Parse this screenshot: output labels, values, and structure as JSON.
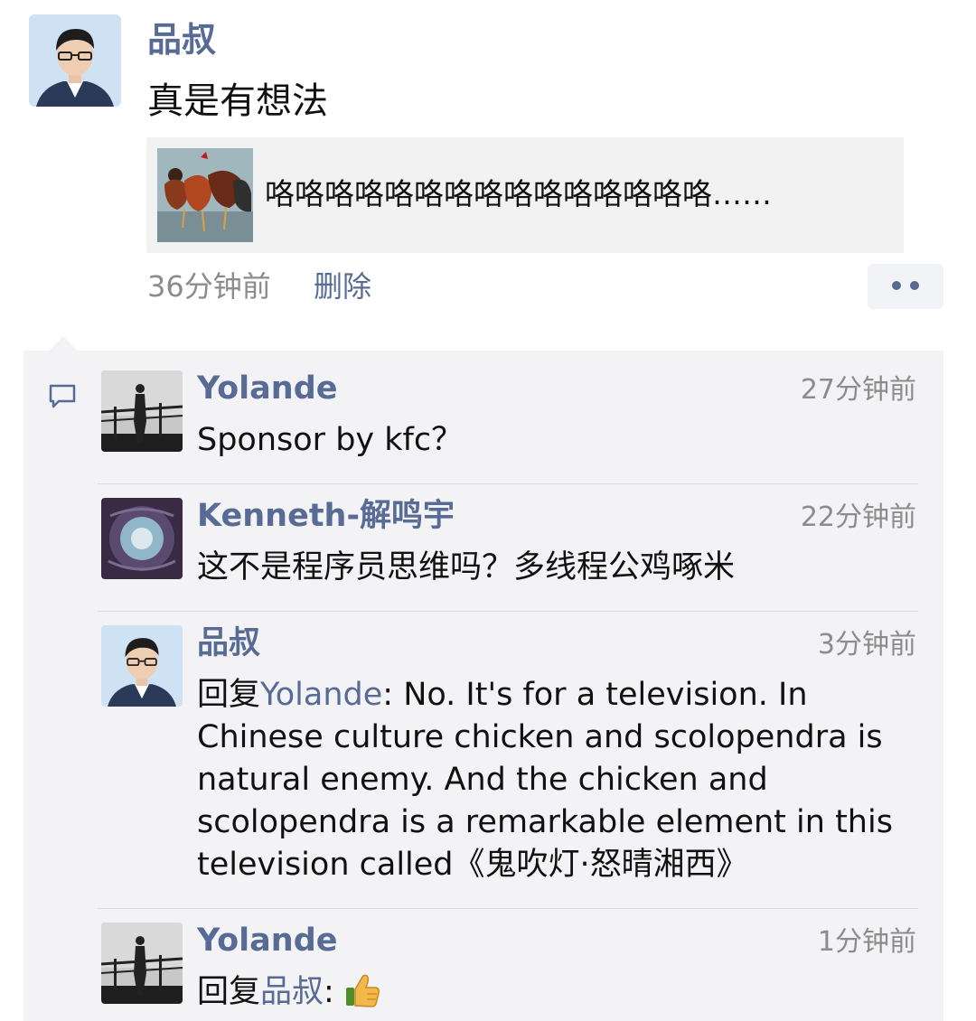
{
  "post": {
    "author": "品叔",
    "text": "真是有想法",
    "link_title": "咯咯咯咯咯咯咯咯咯咯咯咯咯咯咯……",
    "time": "36分钟前",
    "delete_label": "删除"
  },
  "comments": [
    {
      "author": "Yolande",
      "time": "27分钟前",
      "text": "Sponsor by kfc？"
    },
    {
      "author": "Kenneth-解鸣宇",
      "time": "22分钟前",
      "text": "这不是程序员思维吗？多线程公鸡啄米"
    },
    {
      "author": "品叔",
      "time": "3分钟前",
      "reply_prefix": "回复",
      "reply_to": "Yolande",
      "reply_sep": ":",
      "text": " No. It's for a television. In Chinese culture chicken and scolopendra is natural enemy. And the chicken and scolopendra is a remarkable element in this television called《鬼吹灯·怒晴湘西》"
    },
    {
      "author": "Yolande",
      "time": "1分钟前",
      "reply_prefix": "回复",
      "reply_to": "品叔",
      "reply_sep": ":",
      "emoji": "thumbs-up-icon"
    }
  ],
  "colors": {
    "name_link": "#576b95",
    "panel_bg": "#f3f3f5",
    "timestamp": "#8c8c8c"
  }
}
